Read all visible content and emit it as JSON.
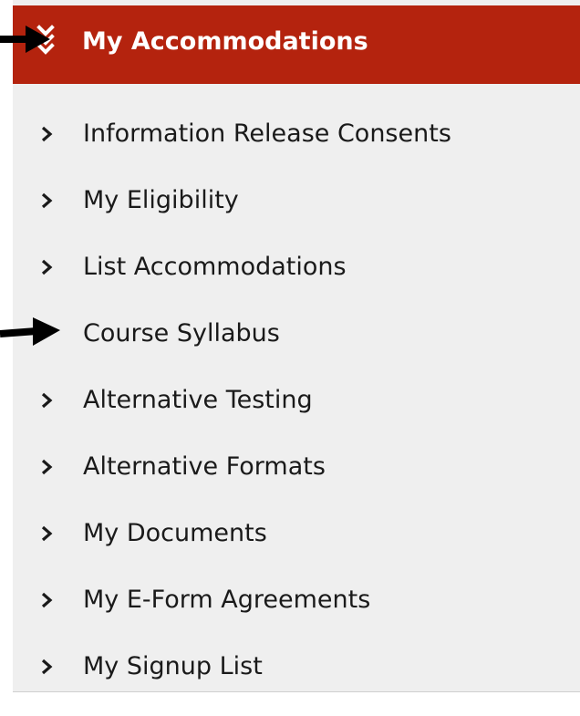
{
  "panel": {
    "header": {
      "title": "My Accommodations",
      "icon": "double-chevron-down-icon",
      "background_color": "#b4230e",
      "text_color": "#ffffff"
    },
    "background_color": "#efefef",
    "items": [
      {
        "label": "Information Release Consents",
        "icon": "chevron-right-icon"
      },
      {
        "label": "My Eligibility",
        "icon": "chevron-right-icon"
      },
      {
        "label": "List Accommodations",
        "icon": "chevron-right-icon"
      },
      {
        "label": "Course Syllabus",
        "icon": "chevron-right-icon",
        "chevron_hidden_by_arrow": true
      },
      {
        "label": "Alternative Testing",
        "icon": "chevron-right-icon"
      },
      {
        "label": "Alternative Formats",
        "icon": "chevron-right-icon"
      },
      {
        "label": "My Documents",
        "icon": "chevron-right-icon"
      },
      {
        "label": "My E-Form Agreements",
        "icon": "chevron-right-icon"
      },
      {
        "label": "My Signup List",
        "icon": "chevron-right-icon"
      }
    ]
  },
  "annotations": [
    {
      "name": "arrow-to-header",
      "points_to": "My Accommodations",
      "color": "#000000"
    },
    {
      "name": "arrow-to-course-syllabus",
      "points_to": "Course Syllabus",
      "color": "#000000"
    }
  ]
}
